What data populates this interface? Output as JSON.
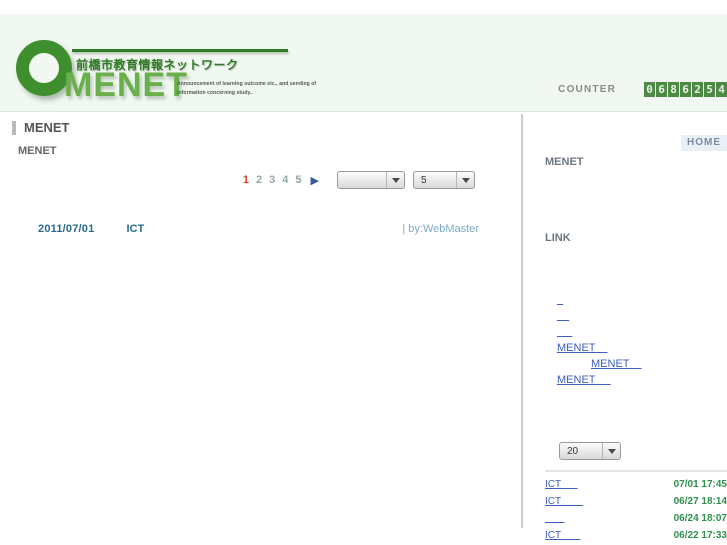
{
  "header": {
    "logo": {
      "ring_icon": "circle-ring-logo",
      "japanese_tagline": "前橋市教育情報ネットワーク",
      "wordmark": "MENET",
      "english_tagline": "Announcement of learning outcome etc., and sending of information concerning study..",
      "brand_green": "#3f8f2f",
      "wordmark_green": "#6ab04a"
    },
    "counter": {
      "label": "COUNTER",
      "digits": [
        "0",
        "6",
        "8",
        "6",
        "2",
        "5",
        "4"
      ],
      "digit_bg": "#4e8a46"
    }
  },
  "main": {
    "page_title": "MENET",
    "sub_title": "MENET",
    "pagination": {
      "pages": [
        "1",
        "2",
        "3",
        "4",
        "5"
      ],
      "active_page": "1",
      "next_icon": "next-arrow-icon",
      "active_color": "#e03a2f"
    },
    "filter_select": {
      "value": "",
      "caret_icon": "chevron-down-icon"
    },
    "perpage_select": {
      "value": "5",
      "caret_icon": "chevron-down-icon"
    },
    "posts": [
      {
        "date": "2011/07/01",
        "subject": "ICT",
        "author": "| by:WebMaster"
      }
    ]
  },
  "sidebar": {
    "home_label": "HOME",
    "menet_heading": "MENET",
    "link_heading": "LINK",
    "links": [
      {
        "label": "  "
      },
      {
        "label": "    "
      },
      {
        "label": "     ",
        "indent": false
      },
      {
        "label": "MENET    "
      },
      {
        "label": "MENET    ",
        "indent": true
      },
      {
        "label": "MENET     "
      }
    ],
    "count_select": {
      "value": "20",
      "caret_icon": "chevron-down-icon"
    },
    "recent_posts": [
      {
        "title": "ICT      ",
        "time": "07/01 17:45"
      },
      {
        "title": "ICT        ",
        "time": "06/27 18:14"
      },
      {
        "title": "       ",
        "time": "06/24 18:07"
      },
      {
        "title": "ICT       ",
        "time": "06/22 17:33"
      }
    ],
    "time_color": "#2f8f4e"
  }
}
